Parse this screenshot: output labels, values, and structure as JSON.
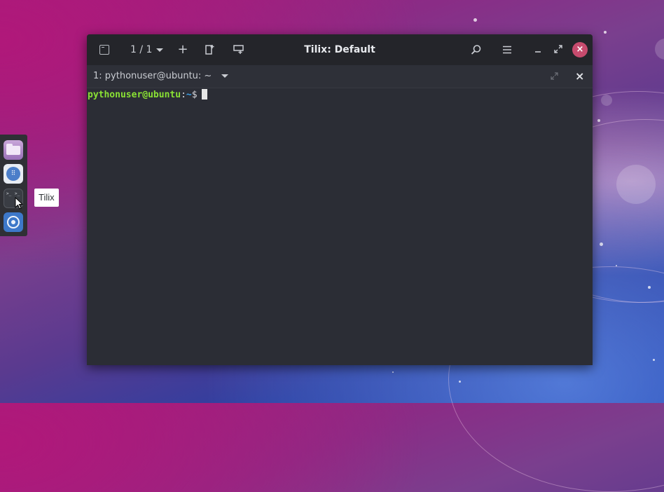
{
  "window": {
    "title": "Tilix: Default",
    "session_count": "1 / 1",
    "close_glyph": "×"
  },
  "tab": {
    "title": "1: pythonuser@ubuntu: ~",
    "close_glyph": "×"
  },
  "terminal": {
    "prompt_user_host": "pythonuser@ubuntu",
    "prompt_separator": ":",
    "prompt_path": "~",
    "prompt_symbol": "$"
  },
  "dock": {
    "items": [
      "files-icon",
      "show-applications-icon",
      "tilix-icon",
      "browser-icon"
    ],
    "tooltip": "Tilix"
  },
  "colors": {
    "prompt_user": "#8ae234",
    "prompt_path": "#3aa0e8",
    "close_button": "#c74b6e",
    "terminal_bg": "#2b2d35"
  }
}
